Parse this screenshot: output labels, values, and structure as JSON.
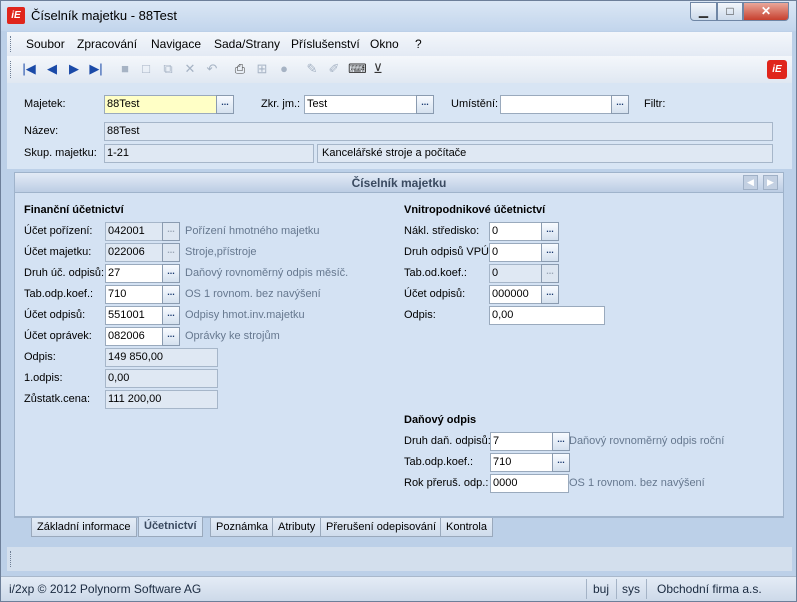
{
  "window": {
    "title": "Číselník majetku - 88Test",
    "app_logo": "iE",
    "minimize": "▁",
    "maximize": "□",
    "close": "✕"
  },
  "menu": [
    "Soubor",
    "Zpracování",
    "Navigace",
    "Sada/Strany",
    "Příslušenství",
    "Okno",
    "?"
  ],
  "toolbar": {
    "icons": [
      "first-record-icon",
      "prev-record-icon",
      "next-record-icon",
      "last-record-icon",
      "save-icon",
      "new-icon",
      "copy-icon",
      "delete-icon",
      "undo-icon",
      "print-icon",
      "structure-icon",
      "stop-icon",
      "edit-icon",
      "marker-icon",
      "notes-icon",
      "filter-icon"
    ],
    "glyphs": [
      "|◀",
      "◀",
      "▶",
      "▶|",
      "■",
      "□",
      "⧉",
      "✕",
      "↶",
      "⎙",
      "⊞",
      "●",
      "✎",
      "✐",
      "⌨",
      "⊻"
    ],
    "logo": "iE"
  },
  "header": {
    "majetek_label": "Majetek:",
    "majetek_value": "88Test",
    "zkr_label": "Zkr. jm.:",
    "zkr_value": "Test",
    "umisteni_label": "Umístění:",
    "umisteni_value": "",
    "filtr_label": "Filtr:",
    "nazev_label": "Název:",
    "nazev_value": "88Test",
    "skup_label": "Skup. majetku:",
    "skup_code": "1-21",
    "skup_name": "Kancelářské stroje a počítače"
  },
  "panel": {
    "title": "Číselník majetku",
    "prev": "◀",
    "next": "▶"
  },
  "financni": {
    "title": "Finanční účetnictví",
    "rows": [
      {
        "label": "Účet pořízení:",
        "value": "042001",
        "desc": "Pořízení hmotného majetku"
      },
      {
        "label": "Účet majetku:",
        "value": "022006",
        "desc": "Stroje,přístroje"
      },
      {
        "label": "Druh úč. odpisů:",
        "value": "27",
        "desc": "Daňový rovnoměrný odpis měsíč."
      },
      {
        "label": "Tab.odp.koef.:",
        "value": "710",
        "desc": "OS 1 rovnom. bez navýšení"
      },
      {
        "label": "Účet odpisů:",
        "value": "551001",
        "desc": "Odpisy hmot.inv.majetku"
      },
      {
        "label": "Účet oprávek:",
        "value": "082006",
        "desc": "Oprávky ke strojům"
      }
    ],
    "odpis_label": "Odpis:",
    "odpis_value": "149 850,00",
    "prvni_label": "1.odpis:",
    "prvni_value": "0,00",
    "zustatek_label": "Zůstatk.cena:",
    "zustatek_value": "111 200,00"
  },
  "vnitro": {
    "title": "Vnitropodnikové účetnictví",
    "rows": [
      {
        "label": "Nákl. středisko:",
        "value": "0"
      },
      {
        "label": "Druh odpisů VPÚ:",
        "value": "0"
      },
      {
        "label": "Tab.od.koef.:",
        "value": "0"
      },
      {
        "label": "Účet odpisů:",
        "value": "000000"
      }
    ],
    "odpis_label": "Odpis:",
    "odpis_value": "0,00"
  },
  "danovy": {
    "title": "Daňový odpis",
    "druh_label": "Druh daň. odpisů:",
    "druh_value": "7",
    "druh_desc": "Daňový rovnoměrný odpis roční",
    "tab_label": "Tab.odp.koef.:",
    "tab_value": "710",
    "rok_label": "Rok přeruš. odp.:",
    "rok_value": "0000",
    "rok_desc": "OS 1 rovnom. bez navýšení"
  },
  "tabs": [
    "Základní informace",
    "Účetnictví",
    "Poznámka",
    "Atributy",
    "Přerušení odepisování",
    "Kontrola"
  ],
  "status": {
    "copyright": "i/2xp © 2012 Polynorm Software AG",
    "mode": "buj",
    "sys": "sys",
    "firm": "Obchodní firma a.s."
  }
}
